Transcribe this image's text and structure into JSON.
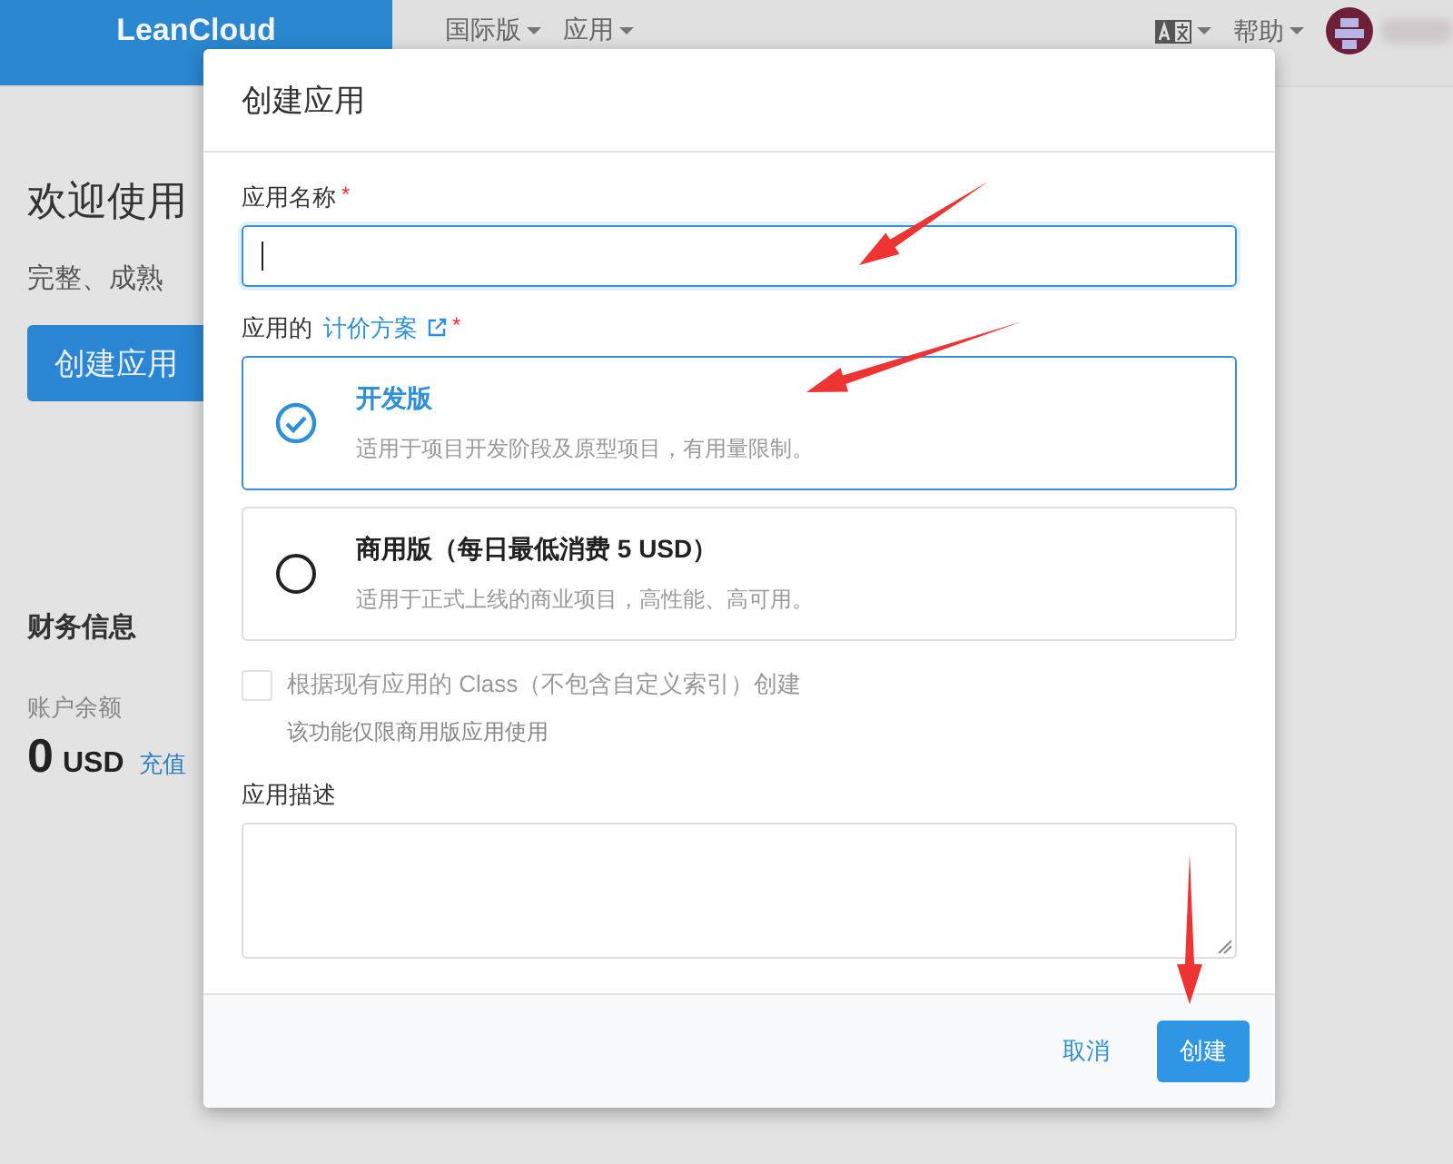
{
  "navbar": {
    "logo": "LeanCloud",
    "menus": [
      {
        "label": "国际版"
      },
      {
        "label": "应用"
      }
    ],
    "help": "帮助"
  },
  "page": {
    "heading": "欢迎使用",
    "subtitle": "完整、成熟",
    "create_button": "创建应用",
    "finance_title": "财务信息",
    "balance_label": "账户余额",
    "balance_amount": "0",
    "balance_unit": "USD",
    "recharge_link": "充值"
  },
  "dialog": {
    "title": "创建应用",
    "name_field": {
      "label": "应用名称",
      "required_mark": "*",
      "focused": true
    },
    "plan_label": "应用的",
    "plan_link": "计价方案",
    "plan_required_mark": "*",
    "plans": [
      {
        "title": "开发版",
        "description": "适用于项目开发阶段及原型项目，有用量限制。",
        "selected": true
      },
      {
        "title": "商用版（每日最低消费 5 USD）",
        "description": "适用于正式上线的商业项目，高性能、高可用。",
        "selected": false
      }
    ],
    "copy_classes": {
      "label": "根据现有应用的 Class（不包含自定义索引）创建",
      "hint": "该功能仅限商用版应用使用",
      "checked": false,
      "disabled": true
    },
    "description_field": {
      "label": "应用描述"
    },
    "buttons": [
      {
        "label": "取消",
        "kind": "link"
      },
      {
        "label": "创建",
        "kind": "primary"
      }
    ]
  }
}
